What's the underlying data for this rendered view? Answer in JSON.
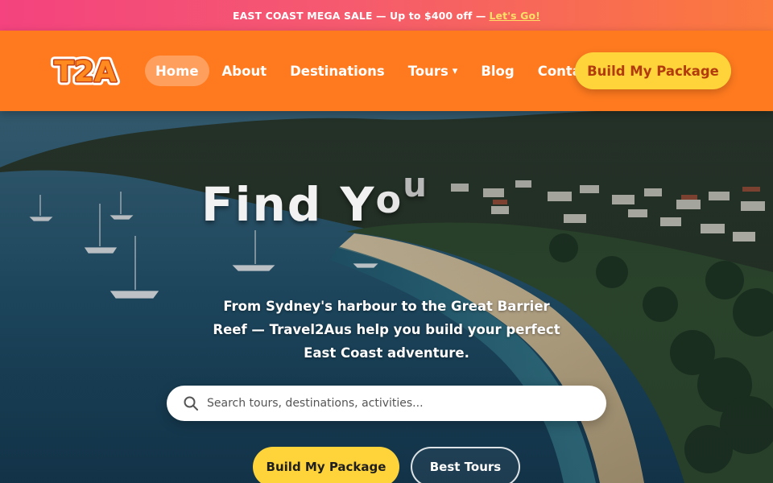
{
  "promo": {
    "text": "EAST COAST MEGA SALE — Up to $400 off —",
    "link": "Let's Go!"
  },
  "nav": {
    "logo_text": "T2A",
    "links": [
      {
        "label": "Home",
        "active": true
      },
      {
        "label": "About"
      },
      {
        "label": "Destinations"
      },
      {
        "label": "Tours"
      },
      {
        "label": "Blog"
      },
      {
        "label": "Contact"
      }
    ],
    "tours_caret": "▾",
    "cta": "Build My Package"
  },
  "hero": {
    "title_parts": [
      "Find",
      "Y",
      "o",
      "u"
    ],
    "subtitle": "From Sydney's harbour to the Great Barrier Reef — Travel2Aus help you build your perfect East Coast adventure.",
    "search_placeholder": "Search tours, destinations, activities...",
    "primary_button": "Build My Package",
    "secondary_button": "Best Tours"
  },
  "colors": {
    "nav_bg": "#ff7a1f",
    "cta_yellow": "#ffd43b",
    "promo_link": "#ffe066"
  }
}
